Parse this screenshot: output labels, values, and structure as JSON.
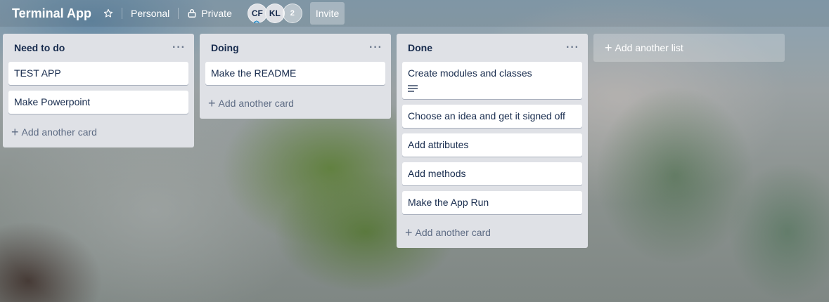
{
  "header": {
    "board_title": "Terminal App",
    "team_label": "Personal",
    "visibility_label": "Private",
    "members": [
      {
        "initials": "CF"
      },
      {
        "initials": "KL"
      }
    ],
    "member_count": "2",
    "invite_label": "Invite"
  },
  "lists": [
    {
      "title": "Need to do",
      "cards": [
        {
          "title": "TEST APP"
        },
        {
          "title": "Make Powerpoint"
        }
      ],
      "add_card_label": "Add another card"
    },
    {
      "title": "Doing",
      "cards": [
        {
          "title": "Make the README"
        }
      ],
      "add_card_label": "Add another card"
    },
    {
      "title": "Done",
      "cards": [
        {
          "title": "Create modules and classes",
          "has_description": true
        },
        {
          "title": "Choose an idea and get it signed off"
        },
        {
          "title": "Add attributes"
        },
        {
          "title": "Add methods"
        },
        {
          "title": "Make the App Run"
        }
      ],
      "add_card_label": "Add another card"
    }
  ],
  "add_list_label": "Add another list",
  "icons": {
    "star": "star-icon",
    "lock": "lock-icon",
    "list_menu": "ellipsis-icon",
    "add": "plus-icon",
    "description": "description-icon"
  },
  "colors": {
    "list_bg": "#dfe1e6",
    "card_bg": "#ffffff",
    "text": "#172b4d",
    "muted": "#5e6c84"
  }
}
